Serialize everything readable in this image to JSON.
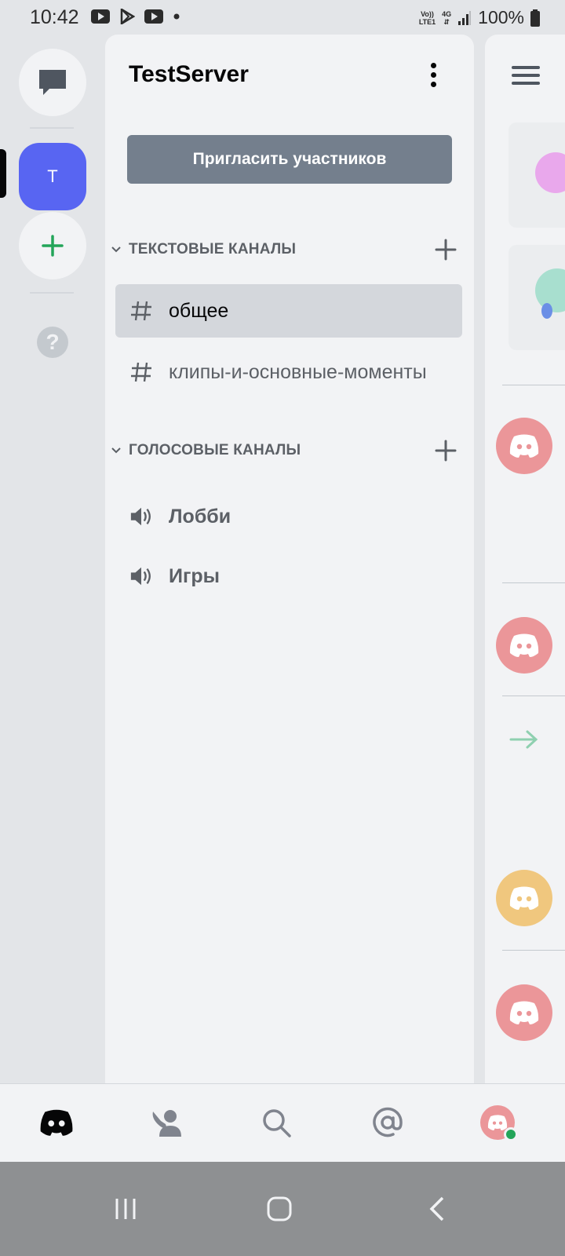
{
  "status_bar": {
    "time": "10:42",
    "volte_top": "Vo))",
    "volte_bottom": "LTE1",
    "network": "4G",
    "battery": "100%"
  },
  "rail": {
    "active_server_initial": "T",
    "help_glyph": "?"
  },
  "server": {
    "name": "TestServer",
    "invite_label": "Пригласить участников"
  },
  "categories": {
    "text": "ТЕКСТОВЫЕ КАНАЛЫ",
    "voice": "ГОЛОСОВЫЕ КАНАЛЫ"
  },
  "text_channels": [
    {
      "name": "общее",
      "active": true
    },
    {
      "name": "клипы-и-основные-моменты",
      "active": false
    }
  ],
  "voice_channels": [
    {
      "name": "Лобби"
    },
    {
      "name": "Игры"
    }
  ],
  "colors": {
    "brand": "#5865f2",
    "add_server": "#23a559",
    "online": "#23a559"
  },
  "icons": {
    "messages": "chat-bubble-icon",
    "add_server": "plus-icon",
    "help": "question-icon",
    "text_channel": "hash-icon",
    "voice_channel": "speaker-icon",
    "tabs": [
      "discord-logo-icon",
      "friends-icon",
      "search-icon",
      "mention-icon",
      "profile-avatar-icon"
    ]
  }
}
